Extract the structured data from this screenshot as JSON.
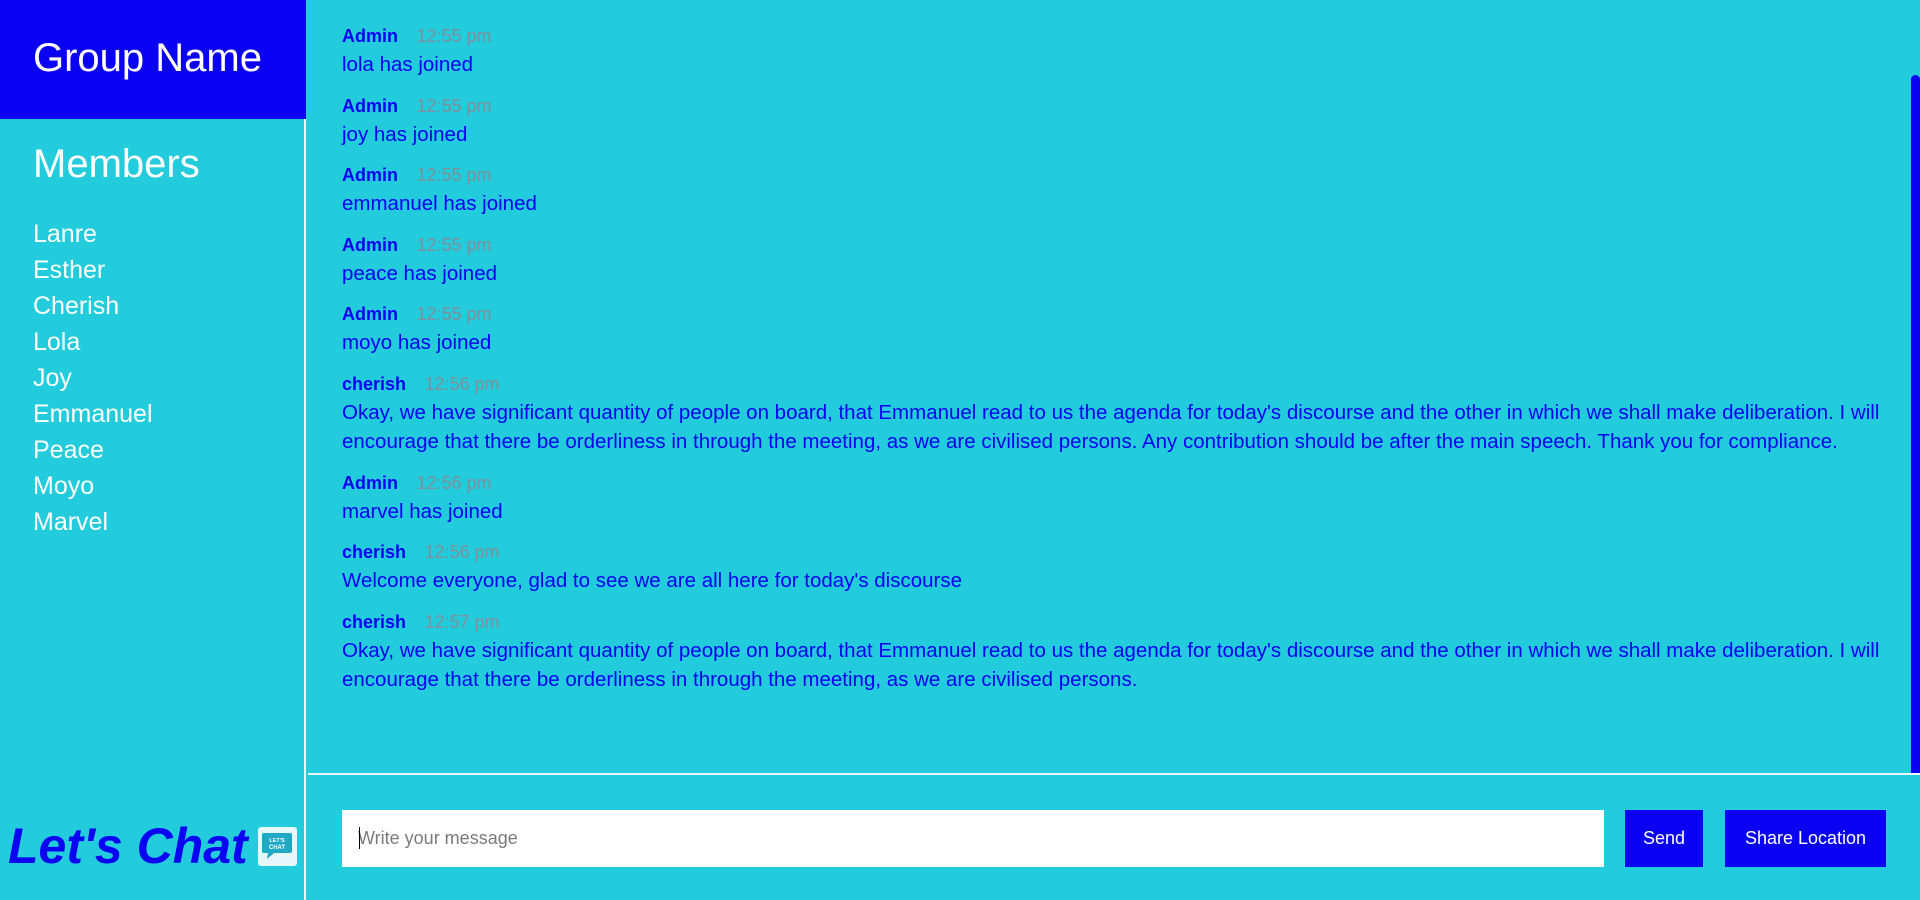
{
  "sidebar": {
    "group_name": "Group Name",
    "members_title": "Members",
    "members": [
      "Lanre",
      "Esther",
      "Cherish",
      "Lola",
      "Joy",
      "Emmanuel",
      "Peace",
      "Moyo",
      "Marvel"
    ],
    "brand": "Let's Chat",
    "brand_logo_icon": "chat-bubble-logo-icon",
    "brand_logo_text": "LET'S CHAT"
  },
  "messages": [
    {
      "author": "Admin",
      "time": "12:55 pm",
      "text": "lola has joined"
    },
    {
      "author": "Admin",
      "time": "12:55 pm",
      "text": "joy has joined"
    },
    {
      "author": "Admin",
      "time": "12:55 pm",
      "text": "emmanuel has joined"
    },
    {
      "author": "Admin",
      "time": "12:55 pm",
      "text": "peace has joined"
    },
    {
      "author": "Admin",
      "time": "12:55 pm",
      "text": "moyo has joined"
    },
    {
      "author": "cherish",
      "time": "12:56 pm",
      "text": "Okay, we have significant quantity of people on board, that Emmanuel read to us the agenda for today's discourse and the other in which we shall make deliberation. I will encourage that there be orderliness in through the meeting, as we are civilised persons. Any contribution should be after the main speech. Thank you for compliance."
    },
    {
      "author": "Admin",
      "time": "12:56 pm",
      "text": "marvel has joined"
    },
    {
      "author": "cherish",
      "time": "12:56 pm",
      "text": "Welcome everyone, glad to see we are all here for today's discourse"
    },
    {
      "author": "cherish",
      "time": "12:57 pm",
      "text": "Okay, we have significant quantity of people on board, that Emmanuel read to us the agenda for today's discourse and the other in which we shall make deliberation. I will encourage that there be orderliness in through the meeting, as we are civilised persons."
    }
  ],
  "composer": {
    "placeholder": "Write your message",
    "value": "",
    "send_label": "Send",
    "share_location_label": "Share Location"
  },
  "colors": {
    "background": "#22CCDD",
    "accent": "#0A00F2",
    "timestamp": "#7E8F9A",
    "divider": "#E6F6FA"
  }
}
